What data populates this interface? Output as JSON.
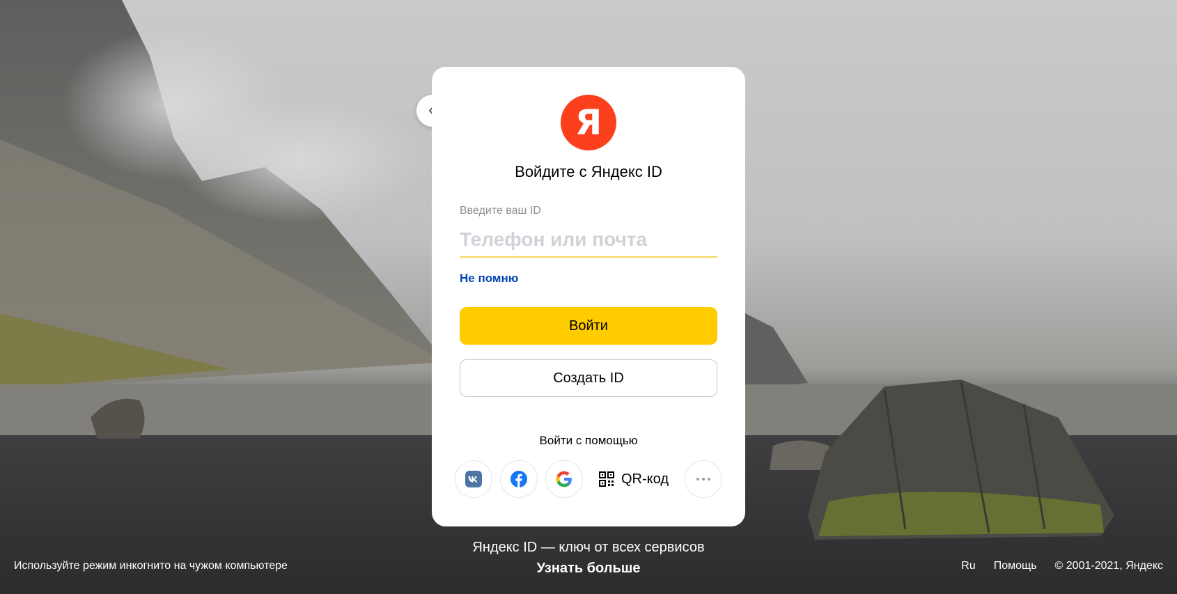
{
  "card": {
    "logo_letter": "Я",
    "title": "Войдите с Яндекс ID",
    "field_label": "Введите ваш ID",
    "login_placeholder": "Телефон или почта",
    "login_value": "",
    "forgot_link": "Не помню",
    "login_button": "Войти",
    "create_button": "Создать ID",
    "social_title": "Войти с помощью",
    "social": {
      "vk_icon": "vk-icon",
      "facebook_icon": "facebook-icon",
      "google_icon": "google-icon",
      "qr_label": "QR-код",
      "more_icon": "more-icon"
    }
  },
  "colors": {
    "logo": "#fc3f1d",
    "primary_button": "#ffcc00",
    "link": "#0044b3",
    "input_underline": "#f5d65c"
  },
  "footer": {
    "tagline": "Яндекс ID — ключ от всех сервисов",
    "learn_more": "Узнать больше",
    "incognito_hint": "Используйте режим инкогнито на чужом компьютере",
    "language": "Ru",
    "help": "Помощь",
    "copyright": "© 2001-2021, Яндекс"
  }
}
